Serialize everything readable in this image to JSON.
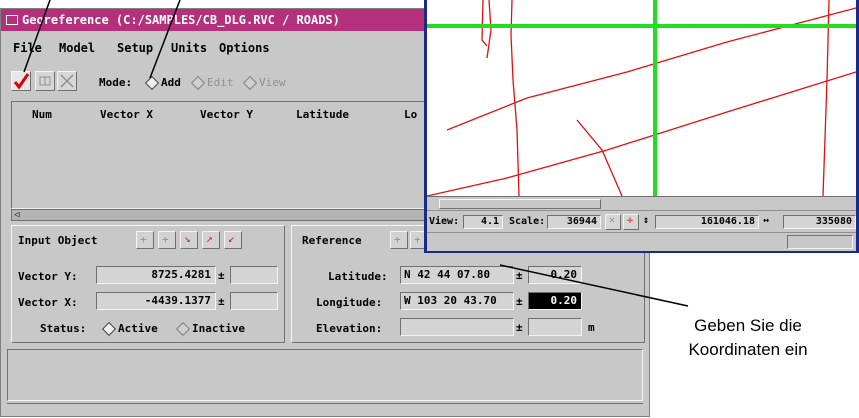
{
  "window": {
    "title": "Georeference (C:/SAMPLES/CB_DLG.RVC / ROADS)"
  },
  "menu": [
    "File",
    "Model",
    "Setup",
    "Units",
    "Options"
  ],
  "toolbar": {
    "mode_label": "Mode:",
    "modes": [
      "Add",
      "Edit",
      "View"
    ],
    "selected_mode": "Add"
  },
  "table": {
    "columns": [
      "Num",
      "Vector X",
      "Vector Y",
      "Latitude",
      "Lo"
    ]
  },
  "input_object": {
    "title": "Input Object",
    "vector_y_label": "Vector Y:",
    "vector_y_value": "8725.4281",
    "vector_x_label": "Vector X:",
    "vector_x_value": "-4439.1377",
    "pm": "±",
    "status_label": "Status:",
    "status_options": [
      "Active",
      "Inactive"
    ],
    "selected_status": "Active"
  },
  "reference": {
    "title": "Reference",
    "latitude_label": "Latitude:",
    "latitude_value": "N 42 44 07.80",
    "latitude_err": "0.20",
    "longitude_label": "Longitude:",
    "longitude_value": "W 103 20 43.70",
    "longitude_err": "0.20",
    "elevation_label": "Elevation:",
    "elevation_unit": "m",
    "pm": "±"
  },
  "map": {
    "view_label": "View:",
    "view_value": "4.1",
    "scale_label": "Scale:",
    "scale_value": "36944",
    "coord1": "161046.18",
    "coord2": "335080"
  },
  "callout": {
    "line1": "Geben Sie die",
    "line2": "Koordinaten ein"
  },
  "colors": {
    "title_bar": "#b4307c",
    "map_border": "#1a2a8c",
    "cross_hair": "#22dd22",
    "roads": "#e01010",
    "checkmark": "#e00000"
  }
}
